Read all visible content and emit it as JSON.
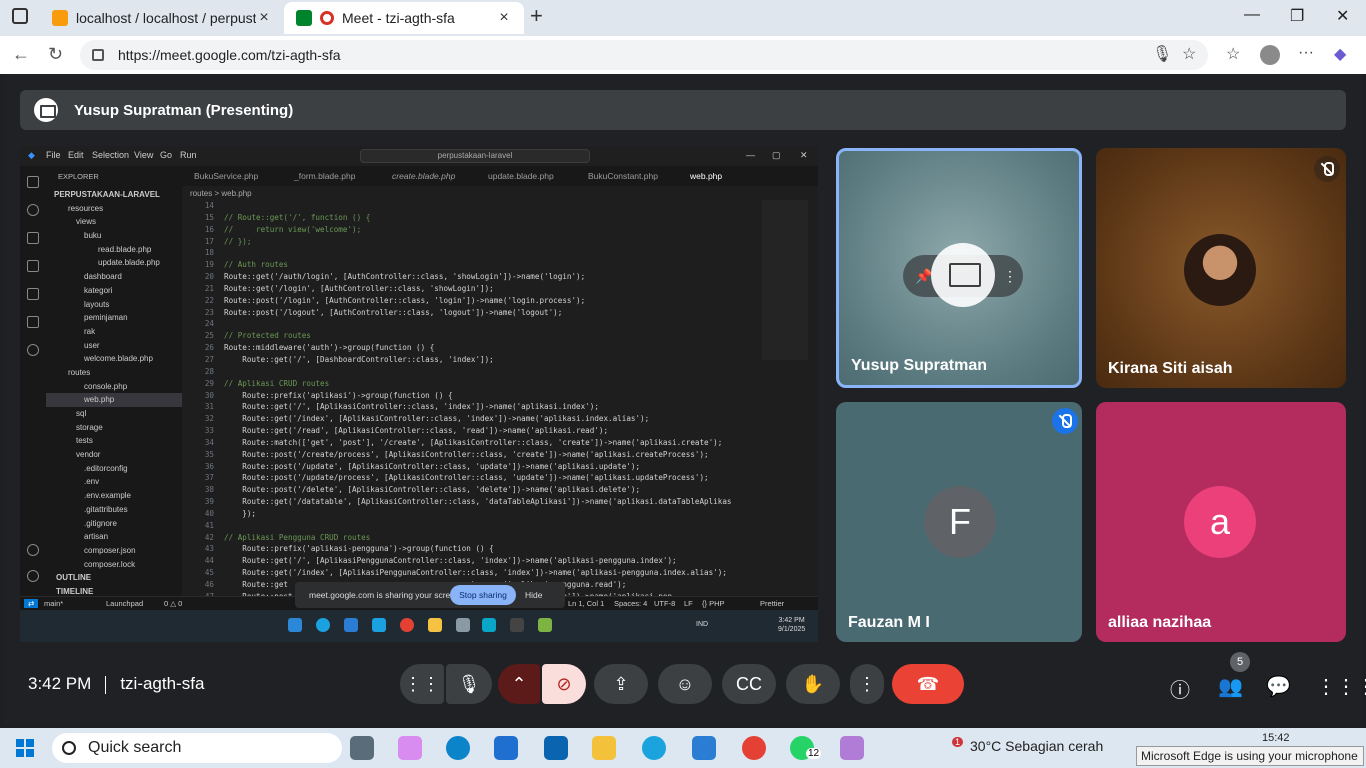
{
  "browser": {
    "tabs": [
      {
        "title": "localhost / localhost / perpustaka",
        "favicon_color": "#f89c0e"
      },
      {
        "title": "Meet - tzi-agth-sfa",
        "favicon_color": "#00832d"
      }
    ],
    "url": "https://meet.google.com/tzi-agth-sfa"
  },
  "presenting_banner": "Yusup Supratman (Presenting)",
  "shared_screen": {
    "menu": [
      "File",
      "Edit",
      "Selection",
      "View",
      "Go",
      "Run"
    ],
    "search": "perpustakaan-laravel",
    "explorer_header": "EXPLORER",
    "tree": [
      "PERPUSTAKAAN-LARAVEL",
      "resources",
      "views",
      "buku",
      "read.blade.php",
      "update.blade.php",
      "dashboard",
      "kategori",
      "layouts",
      "peminjaman",
      "rak",
      "user",
      "welcome.blade.php",
      "routes",
      "console.php",
      "web.php",
      "sql",
      "storage",
      "tests",
      "vendor",
      ".editorconfig",
      ".env",
      ".env.example",
      ".gitattributes",
      ".gitignore",
      "artisan",
      "composer.json",
      "composer.lock",
      "OUTLINE",
      "TIMELINE"
    ],
    "editor_tabs": [
      "BukuService.php",
      "_form.blade.php",
      "create.blade.php",
      "update.blade.php",
      "BukuConstant.php",
      "web.php"
    ],
    "breadcrumb": "routes > web.php",
    "code_lines": [
      {
        "n": "14",
        "t": ""
      },
      {
        "n": "15",
        "t": "// Route::get('/', function () {"
      },
      {
        "n": "16",
        "t": "//     return view('welcome');"
      },
      {
        "n": "17",
        "t": "// });"
      },
      {
        "n": "18",
        "t": ""
      },
      {
        "n": "19",
        "t": "// Auth routes"
      },
      {
        "n": "20",
        "t": "Route::get('/auth/login', [AuthController::class, 'showLogin'])->name('login');"
      },
      {
        "n": "21",
        "t": "Route::get('/login', [AuthController::class, 'showLogin']);"
      },
      {
        "n": "22",
        "t": "Route::post('/login', [AuthController::class, 'login'])->name('login.process');"
      },
      {
        "n": "23",
        "t": "Route::post('/logout', [AuthController::class, 'logout'])->name('logout');"
      },
      {
        "n": "24",
        "t": ""
      },
      {
        "n": "25",
        "t": "// Protected routes"
      },
      {
        "n": "26",
        "t": "Route::middleware('auth')->group(function () {"
      },
      {
        "n": "27",
        "t": "    Route::get('/', [DashboardController::class, 'index']);"
      },
      {
        "n": "28",
        "t": ""
      },
      {
        "n": "29",
        "t": "// Aplikasi CRUD routes"
      },
      {
        "n": "30",
        "t": "    Route::prefix('aplikasi')->group(function () {"
      },
      {
        "n": "31",
        "t": "    Route::get('/', [AplikasiController::class, 'index'])->name('aplikasi.index');"
      },
      {
        "n": "32",
        "t": "    Route::get('/index', [AplikasiController::class, 'index'])->name('aplikasi.index.alias');"
      },
      {
        "n": "33",
        "t": "    Route::get('/read', [AplikasiController::class, 'read'])->name('aplikasi.read');"
      },
      {
        "n": "34",
        "t": "    Route::match(['get', 'post'], '/create', [AplikasiController::class, 'create'])->name('aplikasi.create');"
      },
      {
        "n": "35",
        "t": "    Route::post('/create/process', [AplikasiController::class, 'create'])->name('aplikasi.createProcess');"
      },
      {
        "n": "36",
        "t": "    Route::post('/update', [AplikasiController::class, 'update'])->name('aplikasi.update');"
      },
      {
        "n": "37",
        "t": "    Route::post('/update/process', [AplikasiController::class, 'update'])->name('aplikasi.updateProcess');"
      },
      {
        "n": "38",
        "t": "    Route::post('/delete', [AplikasiController::class, 'delete'])->name('aplikasi.delete');"
      },
      {
        "n": "39",
        "t": "    Route::get('/datatable', [AplikasiController::class, 'dataTableAplikasi'])->name('aplikasi.dataTableAplikas"
      },
      {
        "n": "40",
        "t": "    });"
      },
      {
        "n": "41",
        "t": ""
      },
      {
        "n": "42",
        "t": "// Aplikasi Pengguna CRUD routes"
      },
      {
        "n": "43",
        "t": "    Route::prefix('aplikasi-pengguna')->group(function () {"
      },
      {
        "n": "44",
        "t": "    Route::get('/', [AplikasiPenggunaController::class, 'index'])->name('aplikasi-pengguna.index');"
      },
      {
        "n": "45",
        "t": "    Route::get('/index', [AplikasiPenggunaController::class, 'index'])->name('aplikasi-pengguna.index.alias');"
      },
      {
        "n": "46",
        "t": "    Route::get                                        )->name('aplikasi-pengguna.read');"
      },
      {
        "n": "47",
        "t": "    Route::post                                       oller::class, 'create'])->name('aplikasi-pen"
      }
    ],
    "status_left": [
      "main*",
      "Launchpad",
      "0 △ 0"
    ],
    "status_right": [
      "Ln 1, Col 1",
      "Spaces: 4",
      "UTF-8",
      "LF",
      "{} PHP",
      "Prettier"
    ],
    "sharing_message": "meet.google.com is sharing your screen.",
    "stop_sharing": "Stop sharing",
    "hide": "Hide",
    "remote_tray": {
      "lang": "IND",
      "time": "3:42 PM",
      "date": "9/1/2025"
    }
  },
  "participants": [
    {
      "name": "Yusup Supratman",
      "muted": false
    },
    {
      "name": "Kirana Siti aisah",
      "muted": true
    },
    {
      "name": "Fauzan M I",
      "muted": true,
      "initial": "F",
      "avatar_color": "#5f6368"
    },
    {
      "name": "alliaa nazihaa",
      "muted": false,
      "initial": "a",
      "avatar_color": "#ec407a"
    }
  ],
  "meeting": {
    "time": "3:42 PM",
    "code": "tzi-agth-sfa",
    "people_count": "5"
  },
  "taskbar": {
    "search": "Quick search",
    "weather": "30°C  Sebagian cerah",
    "weather_badge": "1",
    "whatsapp_badge": "12",
    "time": "15:42",
    "toast": "Microsoft Edge is using your microphone"
  }
}
